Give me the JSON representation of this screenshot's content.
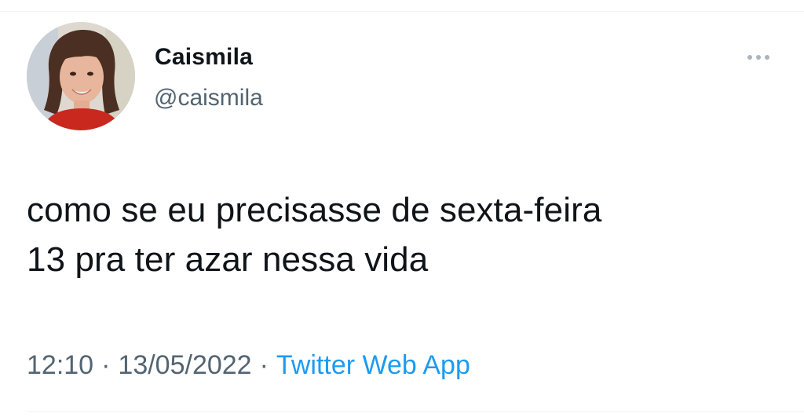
{
  "tweet": {
    "display_name": "Caismila",
    "handle": "@caismila",
    "text_lines": [
      "como se eu precisasse de sexta-feira",
      "13 pra ter azar nessa vida"
    ],
    "time": "12:10",
    "date": "13/05/2022",
    "separator": "·",
    "source": "Twitter Web App",
    "more_icon": "more-horizontal-icon",
    "avatar_icon": "avatar-photo"
  },
  "colors": {
    "text": "#0f1419",
    "secondary": "#536471",
    "link": "#1d9bf0",
    "divider": "#eff3f4"
  }
}
